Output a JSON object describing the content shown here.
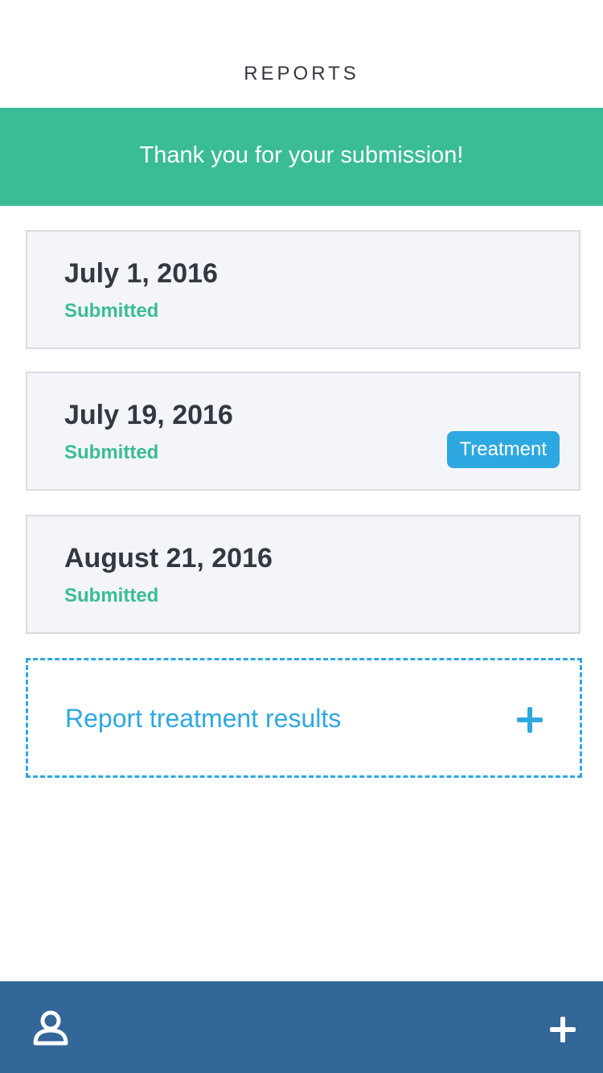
{
  "header": {
    "title": "REPORTS"
  },
  "banner": {
    "message": "Thank you for your submission!",
    "color": "#3abc97"
  },
  "reports": [
    {
      "date": "July 1, 2016",
      "status": "Submitted",
      "badge": ""
    },
    {
      "date": "July 19, 2016",
      "status": "Submitted",
      "badge": "Treatment"
    },
    {
      "date": "August 21, 2016",
      "status": "Submitted",
      "badge": ""
    }
  ],
  "report_action": {
    "label": "Report treatment results",
    "icon": "plus-icon"
  },
  "footer": {
    "left_icon": "profile-icon",
    "right_icon": "plus-icon",
    "color": "#336699"
  },
  "colors": {
    "accent_green": "#3abc97",
    "accent_blue": "#2ea8e0",
    "text_dark": "#333742"
  }
}
